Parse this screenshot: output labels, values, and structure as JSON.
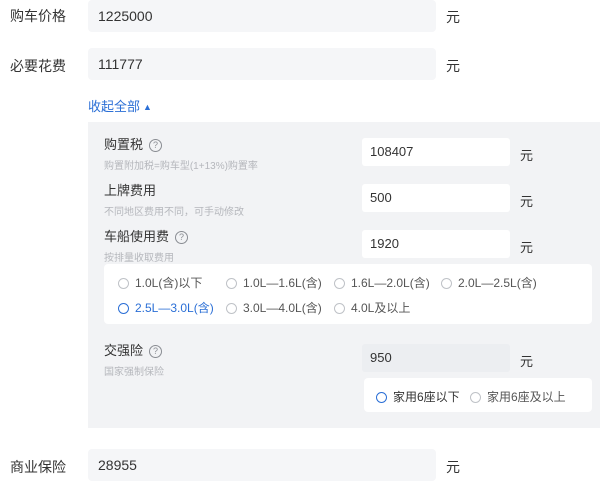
{
  "purchase_price": {
    "label": "购车价格",
    "value": "1225000",
    "unit": "元"
  },
  "required_fees": {
    "label": "必要花费",
    "value": "111777",
    "unit": "元"
  },
  "collapse_toggle": {
    "label": "收起全部",
    "caret": "▲"
  },
  "purchase_tax": {
    "title": "购置税",
    "hint": "购置附加税=购车型(1+13%)购置率",
    "value": "108407",
    "unit": "元",
    "help_icon": "?"
  },
  "registration_fee": {
    "title": "上牌费用",
    "hint": "不同地区费用不同，可手动修改",
    "value": "500",
    "unit": "元"
  },
  "vehicle_tax": {
    "title": "车船使用费",
    "hint": "按排量收取费用",
    "help_icon": "?",
    "value": "1920",
    "unit": "元",
    "options": [
      "1.0L(含)以下",
      "1.0L—1.6L(含)",
      "1.6L—2.0L(含)",
      "2.0L—2.5L(含)",
      "2.5L—3.0L(含)",
      "3.0L—4.0L(含)",
      "4.0L及以上"
    ],
    "selected_index": 4
  },
  "compulsory_insurance": {
    "title": "交强险",
    "hint": "国家强制保险",
    "help_icon": "?",
    "value": "950",
    "unit": "元",
    "options": [
      "家用6座以下",
      "家用6座及以上"
    ],
    "selected_index": 0
  },
  "commercial_insurance": {
    "label": "商业保险",
    "value": "28955",
    "unit": "元"
  },
  "colors": {
    "accent": "#2b6fd6",
    "panel": "#f2f3f5",
    "input": "#f5f6f8"
  }
}
